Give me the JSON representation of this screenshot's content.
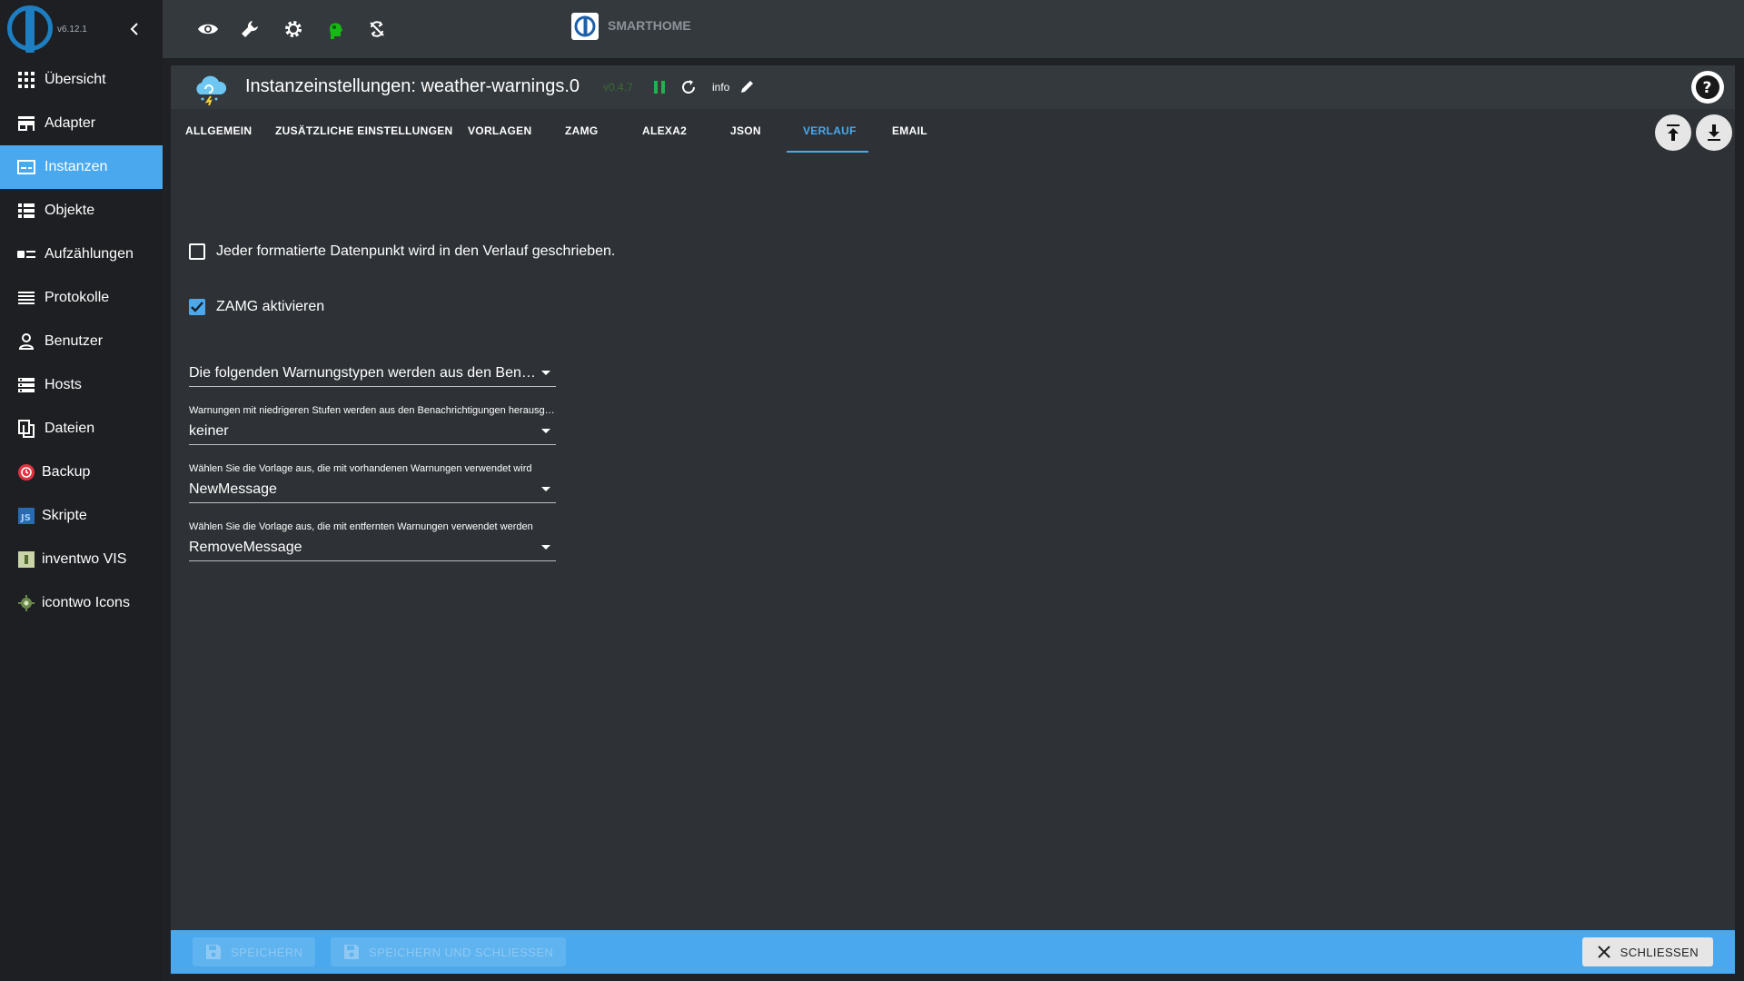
{
  "app": {
    "version": "v6.12.1",
    "brand_label": "SMARTHOME"
  },
  "sidebar": {
    "items": [
      {
        "label": "Übersicht",
        "icon": "grid-icon"
      },
      {
        "label": "Adapter",
        "icon": "store-icon"
      },
      {
        "label": "Instanzen",
        "icon": "instances-icon",
        "active": true
      },
      {
        "label": "Objekte",
        "icon": "list-icon"
      },
      {
        "label": "Aufzählungen",
        "icon": "enum-icon"
      },
      {
        "label": "Protokolle",
        "icon": "logs-icon"
      },
      {
        "label": "Benutzer",
        "icon": "user-icon"
      },
      {
        "label": "Hosts",
        "icon": "hosts-icon"
      },
      {
        "label": "Dateien",
        "icon": "files-icon"
      },
      {
        "label": "Backup",
        "icon": "backup-icon"
      },
      {
        "label": "Skripte",
        "icon": "javascript-icon"
      },
      {
        "label": "inventwo VIS",
        "icon": "inventwo-icon"
      },
      {
        "label": "icontwo Icons",
        "icon": "icontwo-icon"
      }
    ]
  },
  "topbar": {
    "icons": [
      "eye-icon",
      "wrench-icon",
      "gear-icon",
      "head-icon",
      "sync-icon"
    ]
  },
  "panel": {
    "title": "Instanzeinstellungen: weather-warnings.0",
    "version": "v0.4.7",
    "info_label": "info",
    "tabs": [
      {
        "label": "ALLGEMEIN"
      },
      {
        "label": "ZUSÄTZLICHE EINSTELLUNGEN"
      },
      {
        "label": "VORLAGEN"
      },
      {
        "label": "ZAMG"
      },
      {
        "label": "ALEXA2"
      },
      {
        "label": "JSON"
      },
      {
        "label": "VERLAUF",
        "active": true
      },
      {
        "label": "EMAIL"
      }
    ],
    "checkbox_history": {
      "label": "Jeder formatierte Datenpunkt wird in den Verlauf geschrieben.",
      "checked": false
    },
    "checkbox_zamg": {
      "label": "ZAMG aktivieren",
      "checked": true
    },
    "select_types": {
      "value": "Die folgenden Warnungstypen werden aus den Benachrichtigungen"
    },
    "select_levels": {
      "label": "Warnungen mit niedrigeren Stufen werden aus den Benachrichtigungen herausgefiltert",
      "value": "keiner"
    },
    "select_new": {
      "label": "Wählen Sie die Vorlage aus, die mit vorhandenen Warnungen verwendet wird",
      "value": "NewMessage"
    },
    "select_remove": {
      "label": "Wählen Sie die Vorlage aus, die mit entfernten Warnungen verwendet werden",
      "value": "RemoveMessage"
    }
  },
  "footer": {
    "save_label": "SPEICHERN",
    "save_close_label": "SPEICHERN UND SCHLIESSEN",
    "close_label": "SCHLIESSEN"
  },
  "colors": {
    "accent": "#4aa8ee",
    "sidebar_bg": "#1d1f22",
    "panel_bg": "#2e3236",
    "topbar_bg": "#34393d"
  }
}
